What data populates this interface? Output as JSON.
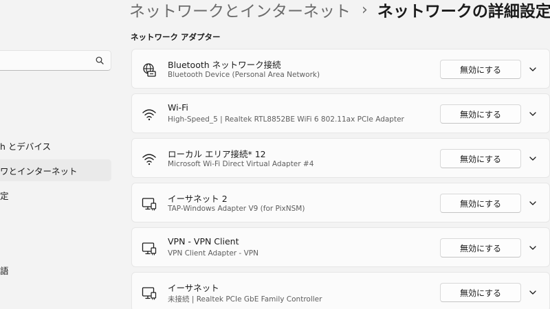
{
  "header": {
    "parent": "ネットワークとインターネット",
    "separator": "›",
    "current": "ネットワークの詳細設定"
  },
  "section": {
    "title": "ネットワーク アダプター"
  },
  "sidebar": {
    "search": {
      "value": "",
      "placeholder": ""
    },
    "items": [
      {
        "label": "h とデバイス",
        "active": false
      },
      {
        "label": "ワとインターネット",
        "active": true
      },
      {
        "label": "定",
        "active": false
      },
      {
        "label": "語",
        "active": false
      }
    ]
  },
  "adapters": [
    {
      "icon": "globe-network-icon",
      "name": "Bluetooth ネットワーク接続",
      "description": "Bluetooth Device (Personal Area Network)",
      "button": "無効にする"
    },
    {
      "icon": "wifi-icon",
      "name": "Wi-Fi",
      "description": "High-Speed_5 | Realtek RTL8852BE WiFi 6 802.11ax PCIe Adapter",
      "button": "無効にする"
    },
    {
      "icon": "wifi-icon",
      "name": "ローカル エリア接続* 12",
      "description": "Microsoft Wi-Fi Direct Virtual Adapter #4",
      "button": "無効にする"
    },
    {
      "icon": "ethernet-monitor-icon",
      "name": "イーサネット 2",
      "description": "TAP-Windows Adapter V9 (for PixNSM)",
      "button": "無効にする"
    },
    {
      "icon": "ethernet-monitor-icon",
      "name": "VPN - VPN Client",
      "description": "VPN Client Adapter - VPN",
      "button": "無効にする"
    },
    {
      "icon": "ethernet-monitor-icon",
      "name": "イーサネット",
      "description": "未接続 | Realtek PCIe GbE Family Controller",
      "button": "無効にする"
    }
  ]
}
